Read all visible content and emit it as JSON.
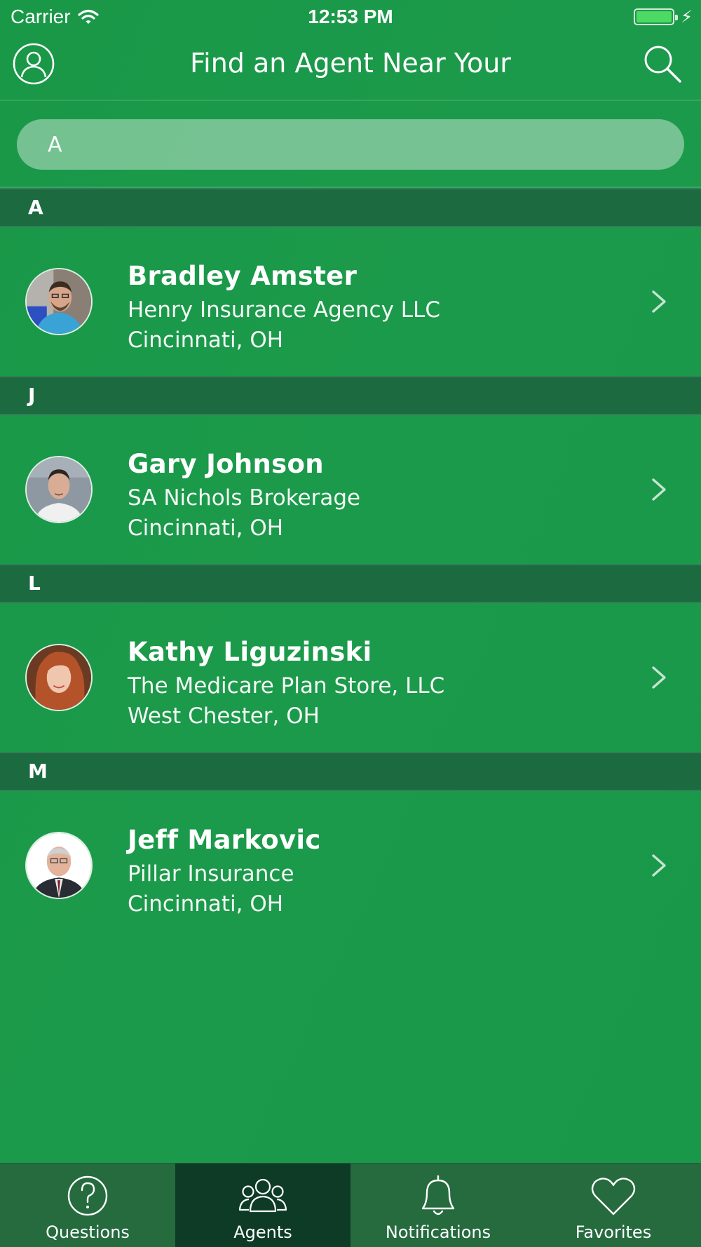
{
  "status_bar": {
    "carrier": "Carrier",
    "time": "12:53 PM",
    "battery_color": "#4cd964"
  },
  "nav": {
    "title": "Find an Agent Near Your",
    "left_icon": "profile-icon",
    "right_icon": "search-icon"
  },
  "search": {
    "value": "A"
  },
  "sections": [
    {
      "letter": "A",
      "agents": [
        {
          "name": "Bradley Amster",
          "agency": "Henry Insurance Agency LLC",
          "city": "Cincinnati, OH"
        }
      ]
    },
    {
      "letter": "J",
      "agents": [
        {
          "name": "Gary Johnson",
          "agency": "SA Nichols Brokerage",
          "city": "Cincinnati, OH"
        }
      ]
    },
    {
      "letter": "L",
      "agents": [
        {
          "name": "Kathy Liguzinski",
          "agency": "The Medicare Plan Store, LLC",
          "city": "West Chester, OH"
        }
      ]
    },
    {
      "letter": "M",
      "agents": [
        {
          "name": "Jeff Markovic",
          "agency": "Pillar Insurance",
          "city": "Cincinnati, OH"
        }
      ]
    }
  ],
  "tabs": [
    {
      "label": "Questions",
      "icon": "question-circle-icon",
      "active": false
    },
    {
      "label": "Agents",
      "icon": "people-group-icon",
      "active": true
    },
    {
      "label": "Notifications",
      "icon": "bell-icon",
      "active": false
    },
    {
      "label": "Favorites",
      "icon": "heart-icon",
      "active": false
    }
  ],
  "colors": {
    "background": "#1a9a4a",
    "section_header": "#1b6a40",
    "tab_bar": "#256b3e",
    "tab_active": "#0e3b26"
  }
}
